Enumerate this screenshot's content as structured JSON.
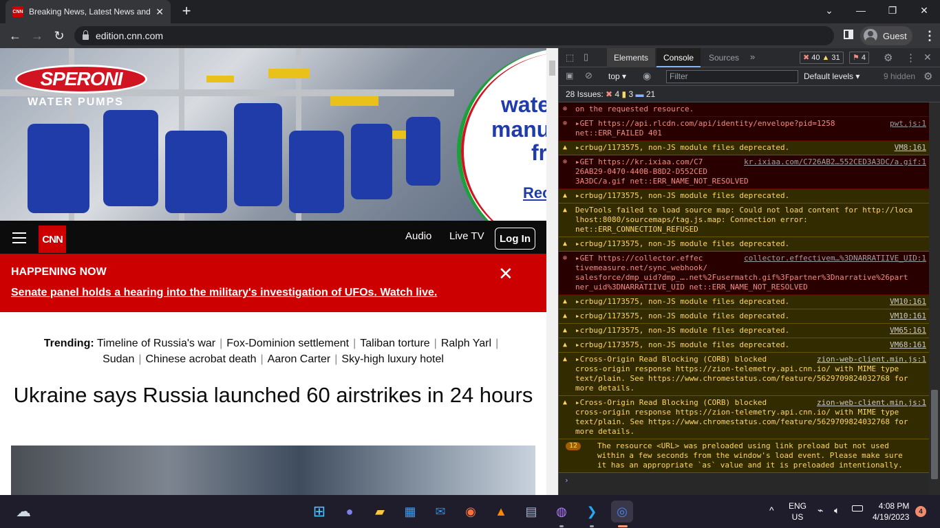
{
  "browser": {
    "tab_title": "Breaking News, Latest News and",
    "tab_favicon": "CNN",
    "url": "edition.cnn.com",
    "profile": "Guest"
  },
  "page": {
    "ad": {
      "brand": "SPERONI",
      "tagline": "WATER PUMPS",
      "right_lines": [
        "wate",
        "manu",
        "fr",
        "Rec"
      ]
    },
    "nav": {
      "logo": "CNN",
      "links": [
        "Audio",
        "Live TV"
      ],
      "login": "Log In"
    },
    "happening": {
      "label": "HAPPENING NOW",
      "text": "Senate panel holds a hearing into the military's investigation of UFOs. Watch live."
    },
    "trending": {
      "label": "Trending:",
      "items": [
        "Timeline of Russia's war",
        "Fox-Dominion settlement",
        "Taliban torture",
        "Ralph Yarl",
        "Sudan",
        "Chinese acrobat death",
        "Aaron Carter",
        "Sky-high luxury hotel"
      ]
    },
    "headline": "Ukraine says Russia launched 60 airstrikes in 24 hours"
  },
  "devtools": {
    "tabs": [
      "Elements",
      "Console",
      "Sources"
    ],
    "counts": {
      "errors": "40",
      "warnings": "31",
      "issues_badge": "4"
    },
    "context": "top",
    "filter_placeholder": "Filter",
    "levels": "Default levels",
    "hidden": "9 hidden",
    "issues": {
      "label": "28 Issues:",
      "err": "4",
      "warn": "3",
      "info": "21"
    },
    "messages": [
      {
        "type": "err",
        "text": "on the requested resource.",
        "src": ""
      },
      {
        "type": "err",
        "text": "▸GET https://api.rlcdn.com/api/identity/envelope?pid=1258\nnet::ERR_FAILED 401",
        "src": "pwt.js:1"
      },
      {
        "type": "warn",
        "text": "▸crbug/1173575, non-JS module files deprecated.",
        "src": "VM8:161"
      },
      {
        "type": "err",
        "text": "▸GET https://kr.ixiaa.com/C7\n26AB29-0470-440B-B8D2-D552CED\n3A3DC/a.gif net::ERR_NAME_NOT_RESOLVED",
        "src": "kr.ixiaa.com/C726AB2…552CED3A3DC/a.gif:1"
      },
      {
        "type": "warn",
        "text": "▸crbug/1173575, non-JS module files deprecated.",
        "src": ""
      },
      {
        "type": "warn",
        "text": "DevTools failed to load source map: Could not load content for http://loca\nlhost:8080/sourcemaps/tag.js.map: Connection error:\nnet::ERR_CONNECTION_REFUSED",
        "src": ""
      },
      {
        "type": "warn",
        "text": "▸crbug/1173575, non-JS module files deprecated.",
        "src": ""
      },
      {
        "type": "err",
        "text": "▸GET https://collector.effec\ntivemeasure.net/sync_webhook/\nsalesforce/dmp_uid?dmp_….net%2Fusermatch.gif%3Fpartner%3Dnarrative%26part\nner_uid%3DNARRATIIVE_UID net::ERR_NAME_NOT_RESOLVED",
        "src": "collector.effectivem…%3DNARRATIIVE_UID:1"
      },
      {
        "type": "warn",
        "text": "▸crbug/1173575, non-JS module files deprecated.",
        "src": "VM10:161"
      },
      {
        "type": "warn",
        "text": "▸crbug/1173575, non-JS module files deprecated.",
        "src": "VM10:161"
      },
      {
        "type": "warn",
        "text": "▸crbug/1173575, non-JS module files deprecated.",
        "src": "VM65:161"
      },
      {
        "type": "warn",
        "text": "▸crbug/1173575, non-JS module files deprecated.",
        "src": "VM68:161"
      },
      {
        "type": "warn",
        "text": "▸Cross-Origin Read Blocking (CORB) blocked\ncross-origin response https://zion-telemetry.api.cnn.io/ with MIME type\ntext/plain. See https://www.chromestatus.com/feature/5629709824032768 for\nmore details.",
        "src": "zion-web-client.min.js:1"
      },
      {
        "type": "warn",
        "text": "▸Cross-Origin Read Blocking (CORB) blocked\ncross-origin response https://zion-telemetry.api.cnn.io/ with MIME type\ntext/plain. See https://www.chromestatus.com/feature/5629709824032768 for\nmore details.",
        "src": "zion-web-client.min.js:1"
      },
      {
        "type": "warn",
        "count": "12",
        "text": "The resource <URL> was preloaded using link preload but not used\nwithin a few seconds from the window's load event. Please make sure\nit has an appropriate `as` value and it is preloaded intentionally.",
        "src": ""
      }
    ],
    "prompt": "›"
  },
  "taskbar": {
    "lang": [
      "ENG",
      "US"
    ],
    "time": "4:08 PM",
    "date": "4/19/2023",
    "notifications": "4",
    "apps": [
      "start-icon",
      "teams-icon",
      "file-explorer-icon",
      "store-icon",
      "mail-icon",
      "firefox-icon",
      "vlc-icon",
      "remote-desktop-icon",
      "github-icon",
      "vscode-icon",
      "chrome-icon"
    ]
  }
}
